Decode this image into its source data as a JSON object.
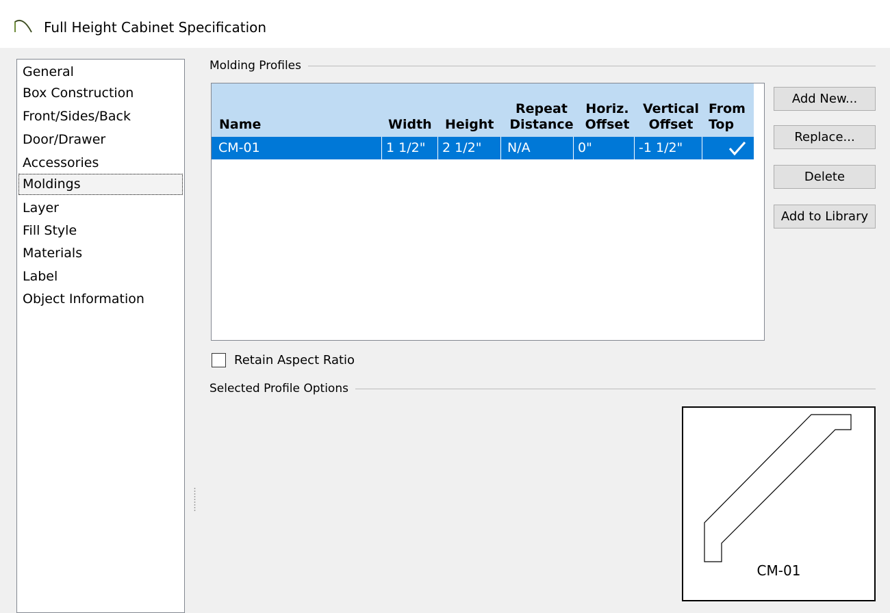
{
  "window": {
    "title": "Full Height Cabinet Specification"
  },
  "nav": {
    "items": [
      {
        "label": "General"
      },
      {
        "label": "Box Construction"
      },
      {
        "label": "Front/Sides/Back"
      },
      {
        "label": "Door/Drawer"
      },
      {
        "label": "Accessories"
      },
      {
        "label": "Moldings",
        "selected": true
      },
      {
        "label": "Layer"
      },
      {
        "label": "Fill Style"
      },
      {
        "label": "Materials"
      },
      {
        "label": "Label"
      },
      {
        "label": "Object Information"
      }
    ]
  },
  "molding_profiles": {
    "group_label": "Molding Profiles",
    "columns": [
      {
        "line1": "",
        "line2": "Name"
      },
      {
        "line1": "",
        "line2": "Width"
      },
      {
        "line1": "",
        "line2": "Height"
      },
      {
        "line1": "Repeat",
        "line2": "Distance"
      },
      {
        "line1": "Horiz.",
        "line2": "Offset"
      },
      {
        "line1": "Vertical",
        "line2": "Offset"
      },
      {
        "line1": "From",
        "line2": "Top"
      }
    ],
    "rows": [
      {
        "name": "CM-01",
        "width": "1 1/2\"",
        "height": "2 1/2\"",
        "repeat_distance": "N/A",
        "horiz_offset": "0\"",
        "vertical_offset": "-1 1/2\"",
        "from_top": true
      }
    ]
  },
  "buttons": {
    "add_new": "Add New...",
    "replace": "Replace...",
    "delete": "Delete",
    "add_to_library": "Add to Library"
  },
  "retain_aspect_ratio": {
    "label": "Retain Aspect Ratio",
    "checked": false
  },
  "selected_profile_options": {
    "group_label": "Selected Profile Options",
    "preview_label": "CM-01"
  },
  "colors": {
    "selection": "#0078d7",
    "header": "#bfdbf3",
    "title_icon": "#6e8c3a"
  }
}
